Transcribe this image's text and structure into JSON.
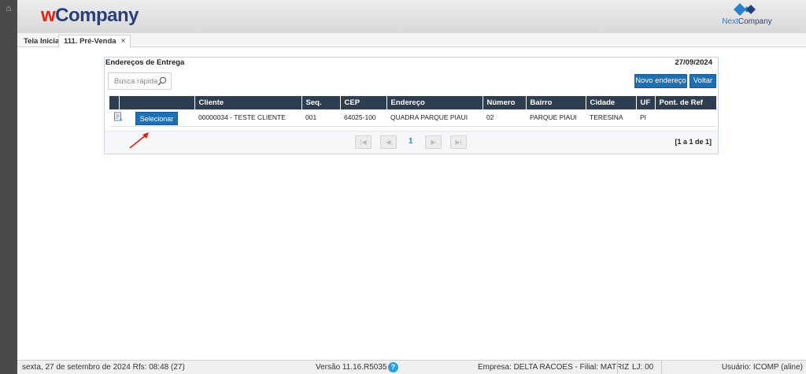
{
  "brand": {
    "logo_w": "w",
    "logo_rest": "Company",
    "partner_logo": "NextCompany",
    "partner_logo_a": "Next",
    "partner_logo_b": "Company"
  },
  "tabs": [
    {
      "label": "Tela Inicial"
    },
    {
      "label": "111. Pré-Venda",
      "close": "×"
    }
  ],
  "panel": {
    "title": "Endereços de Entrega",
    "date": "27/09/2024",
    "search_placeholder": "Busca rápida",
    "new_address_label": "Novo endereço",
    "back_label": "Voltar"
  },
  "grid": {
    "columns": [
      "",
      "",
      "Cliente",
      "Seq.",
      "CEP",
      "Endereço",
      "Número",
      "Bairro",
      "Cidade",
      "UF",
      "Pont. de Ref"
    ],
    "rows": [
      {
        "select_label": "Selecionar",
        "cliente": "00000034 - TESTE CLIENTE",
        "seq": "001",
        "cep": "64025-100",
        "endereco": "QUADRA PARQUE PIAUI",
        "numero": "02",
        "bairro": "PARQUE PIAUI",
        "cidade": "TERESINA",
        "uf": "PI",
        "pont_ref": ""
      }
    ]
  },
  "pager": {
    "current_page": "1",
    "info": "[1 a 1 de 1]"
  },
  "status": {
    "date": "sexta, 27 de setembro de 2024  Rfs: 08:48 (27)",
    "version": "Versão 11.16.R5035",
    "help": "?",
    "company": "Empresa: DELTA RACOES - Filial: MATRIZ",
    "lj": "LJ: 00",
    "user": "Usuário: ICOMP (aline)"
  },
  "colors": {
    "header_dark": "#2e3e50",
    "button_blue": "#1f6fb3",
    "logo_red": "#d8261c",
    "logo_navy": "#2a3f7a",
    "left_bar": "#4a4a4a"
  },
  "icons": [
    "home-icon",
    "search-icon",
    "document-icon",
    "help-icon",
    "first-page-icon",
    "prev-page-icon",
    "next-page-icon",
    "last-page-icon",
    "close-icon"
  ]
}
